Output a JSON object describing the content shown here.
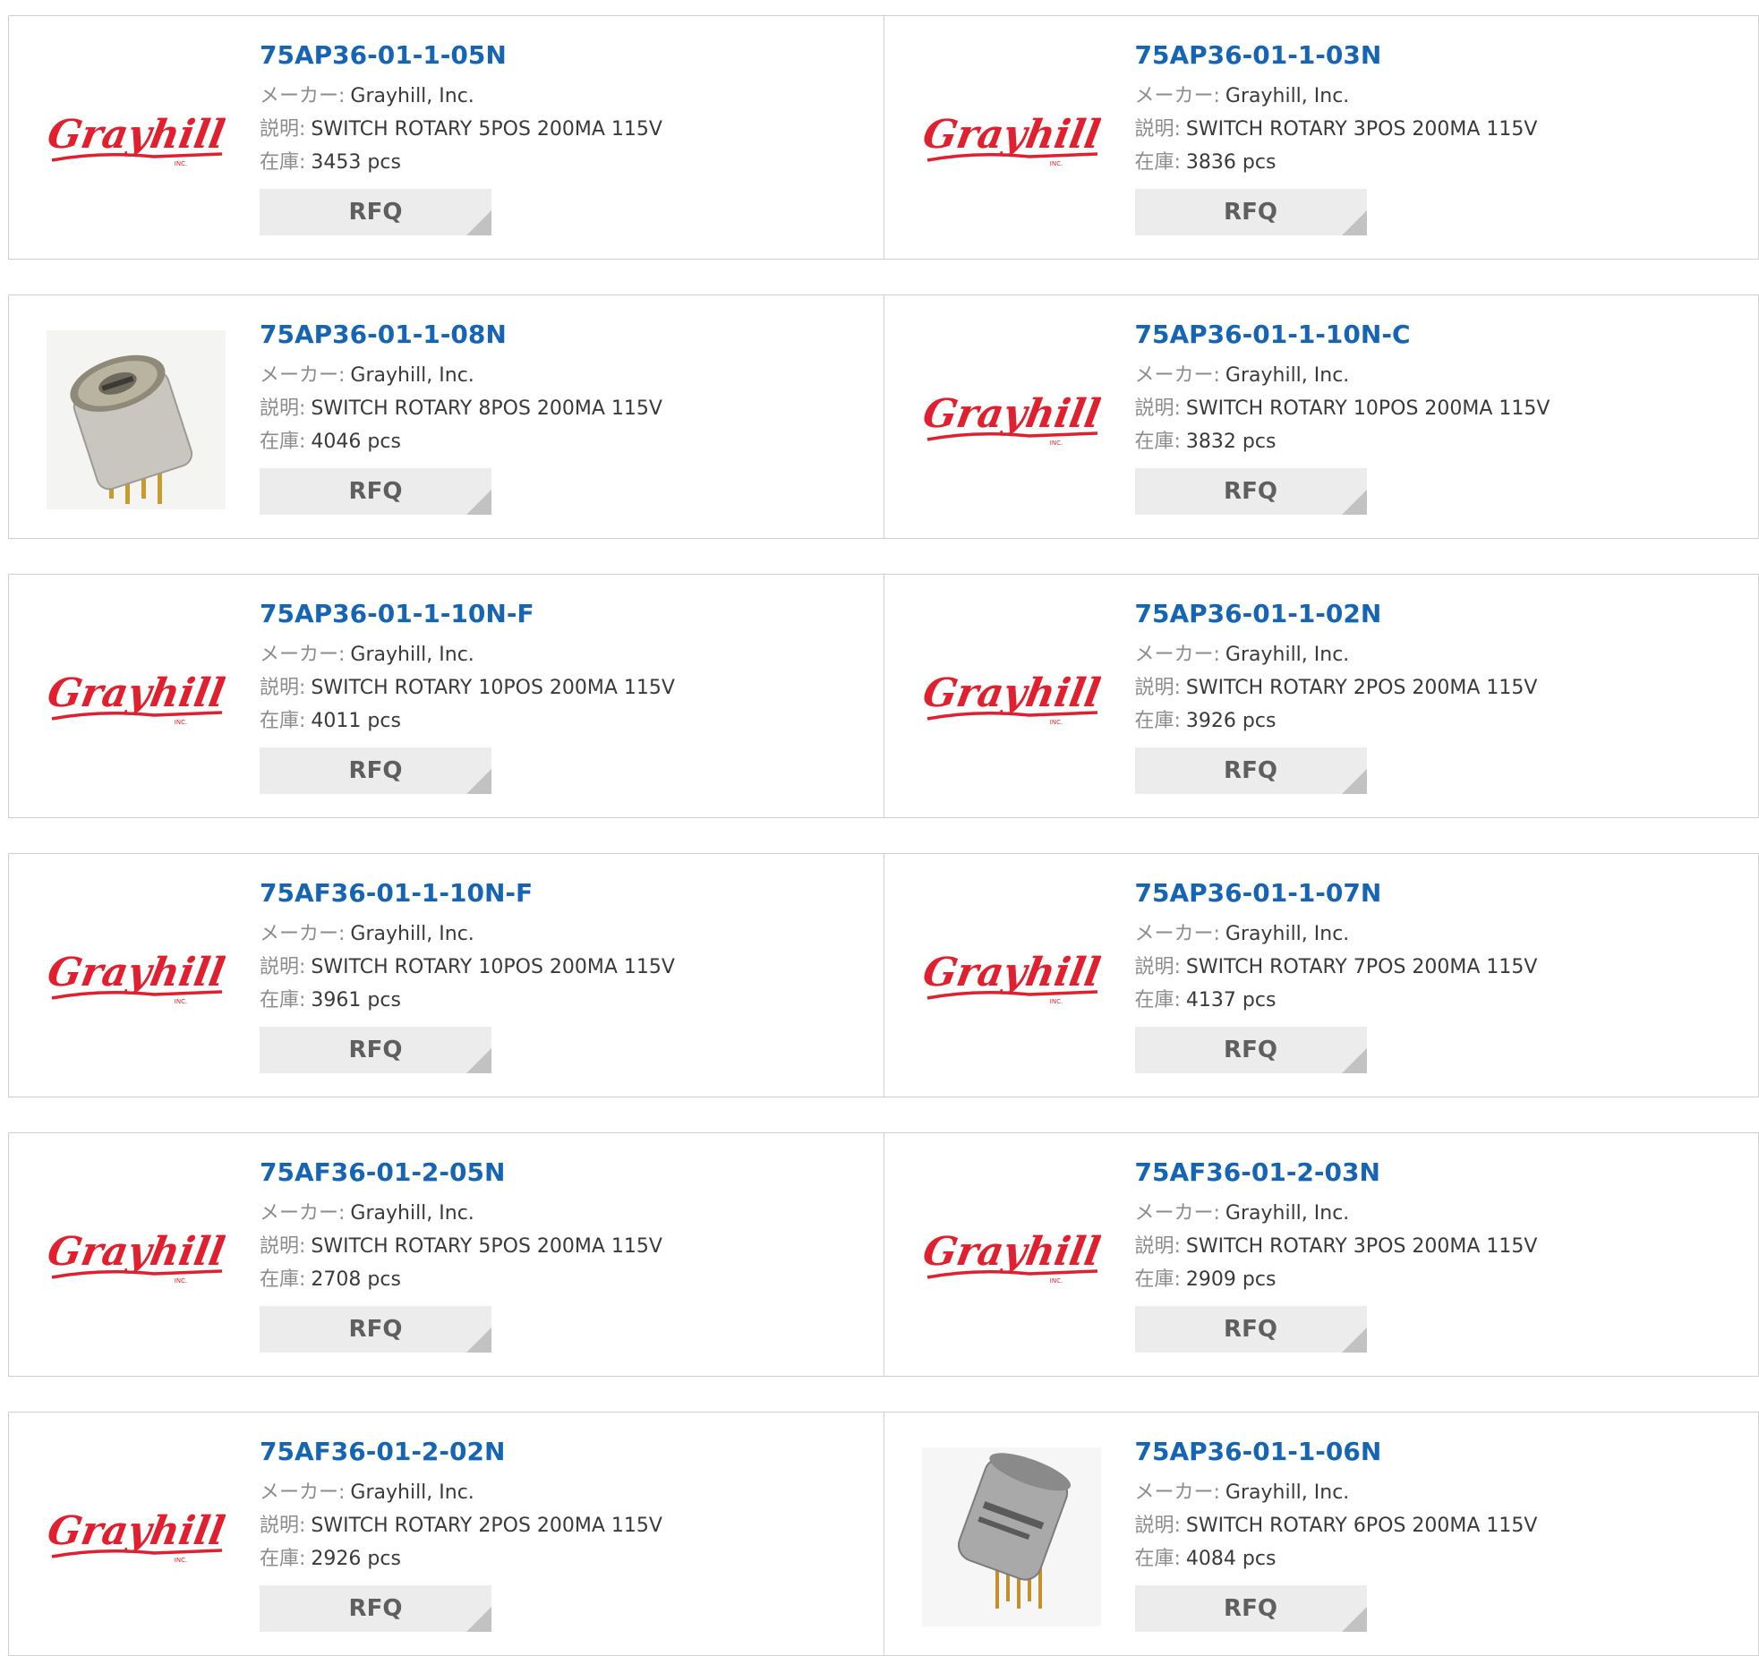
{
  "labels": {
    "maker": "メーカー:",
    "desc": "説明:",
    "stock": "在庫:",
    "rfq": "RFQ"
  },
  "logo": {
    "text": "Grayhill",
    "sub": "INC.",
    "color": "#e0202e"
  },
  "products": [
    {
      "part": "75AP36-01-1-05N",
      "maker": "Grayhill, Inc.",
      "desc": "SWITCH ROTARY 5POS 200MA 115V",
      "stock": "3453 pcs",
      "image": "logo"
    },
    {
      "part": "75AP36-01-1-03N",
      "maker": "Grayhill, Inc.",
      "desc": "SWITCH ROTARY 3POS 200MA 115V",
      "stock": "3836 pcs",
      "image": "logo"
    },
    {
      "part": "75AP36-01-1-08N",
      "maker": "Grayhill, Inc.",
      "desc": "SWITCH ROTARY 8POS 200MA 115V",
      "stock": "4046 pcs",
      "image": "switch-photo"
    },
    {
      "part": "75AP36-01-1-10N-C",
      "maker": "Grayhill, Inc.",
      "desc": "SWITCH ROTARY 10POS 200MA 115V",
      "stock": "3832 pcs",
      "image": "logo"
    },
    {
      "part": "75AP36-01-1-10N-F",
      "maker": "Grayhill, Inc.",
      "desc": "SWITCH ROTARY 10POS 200MA 115V",
      "stock": "4011 pcs",
      "image": "logo"
    },
    {
      "part": "75AP36-01-1-02N",
      "maker": "Grayhill, Inc.",
      "desc": "SWITCH ROTARY 2POS 200MA 115V",
      "stock": "3926 pcs",
      "image": "logo"
    },
    {
      "part": "75AF36-01-1-10N-F",
      "maker": "Grayhill, Inc.",
      "desc": "SWITCH ROTARY 10POS 200MA 115V",
      "stock": "3961 pcs",
      "image": "logo"
    },
    {
      "part": "75AP36-01-1-07N",
      "maker": "Grayhill, Inc.",
      "desc": "SWITCH ROTARY 7POS 200MA 115V",
      "stock": "4137 pcs",
      "image": "logo"
    },
    {
      "part": "75AF36-01-2-05N",
      "maker": "Grayhill, Inc.",
      "desc": "SWITCH ROTARY 5POS 200MA 115V",
      "stock": "2708 pcs",
      "image": "logo"
    },
    {
      "part": "75AF36-01-2-03N",
      "maker": "Grayhill, Inc.",
      "desc": "SWITCH ROTARY 3POS 200MA 115V",
      "stock": "2909 pcs",
      "image": "logo"
    },
    {
      "part": "75AF36-01-2-02N",
      "maker": "Grayhill, Inc.",
      "desc": "SWITCH ROTARY 2POS 200MA 115V",
      "stock": "2926 pcs",
      "image": "logo"
    },
    {
      "part": "75AP36-01-1-06N",
      "maker": "Grayhill, Inc.",
      "desc": "SWITCH ROTARY 6POS 200MA 115V",
      "stock": "4084 pcs",
      "image": "encoder-photo"
    }
  ]
}
